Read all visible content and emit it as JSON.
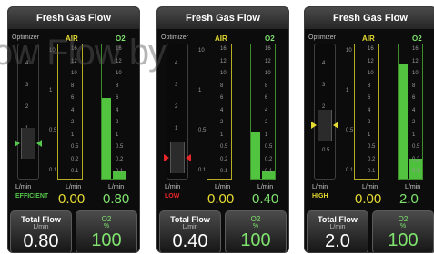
{
  "watermark": "ow Flow by",
  "panels": [
    {
      "title": "Fresh Gas Flow",
      "optimizer_label": "Optimizer",
      "air_label": "AIR",
      "o2_label": "O2",
      "unit_label": "L/min",
      "efficiency_status": "EFFICIENT",
      "efficiency_color": "#56c84b",
      "air_flow": "0.00",
      "o2_flow": "0.80",
      "o2_level": 0.6,
      "total_flow_label": "Total Flow",
      "total_flow_unit": "L/min",
      "total_flow": "0.80",
      "o2_percent_label": "O2",
      "o2_percent_unit": "%",
      "o2_percent": "100",
      "optimizer_ticks": [
        "4",
        "3",
        "2",
        "1",
        "0.5"
      ],
      "flow_ticks": [
        "10",
        "1",
        "0.5",
        "0.1"
      ],
      "o2_scale_ticks": [
        "16",
        "12",
        "10",
        "8",
        "6",
        "4",
        "2",
        "1",
        "0.5",
        "0.2",
        "0.1"
      ]
    },
    {
      "title": "Fresh Gas Flow",
      "optimizer_label": "Optimizer",
      "air_label": "AIR",
      "o2_label": "O2",
      "unit_label": "L/min",
      "efficiency_status": "LOW",
      "efficiency_color": "#e8262a",
      "air_flow": "0.00",
      "o2_flow": "0.40",
      "o2_level": 0.35,
      "total_flow_label": "Total Flow",
      "total_flow_unit": "L/min",
      "total_flow": "0.40",
      "o2_percent_label": "O2",
      "o2_percent_unit": "%",
      "o2_percent": "100",
      "optimizer_ticks": [
        "4",
        "3",
        "2",
        "1",
        "0.5"
      ],
      "flow_ticks": [
        "10",
        "1",
        "0.5",
        "0.1"
      ],
      "o2_scale_ticks": [
        "16",
        "12",
        "10",
        "8",
        "6",
        "4",
        "2",
        "1",
        "0.5",
        "0.2",
        "0.1"
      ]
    },
    {
      "title": "Fresh Gas Flow",
      "optimizer_label": "Optimizer",
      "air_label": "AIR",
      "o2_label": "O2",
      "unit_label": "L/min",
      "efficiency_status": "HIGH",
      "efficiency_color": "#e6dc32",
      "air_flow": "0.00",
      "o2_flow": "2.0",
      "o2_level": 0.85,
      "total_flow_label": "Total Flow",
      "total_flow_unit": "L/min",
      "total_flow": "2.0",
      "o2_percent_label": "O2",
      "o2_percent_unit": "%",
      "o2_percent": "100",
      "optimizer_ticks": [
        "4",
        "3",
        "2",
        "1",
        "0.5"
      ],
      "flow_ticks": [
        "10",
        "1",
        "0.5",
        "0.1"
      ],
      "o2_scale_ticks": [
        "16",
        "12",
        "10",
        "8",
        "6",
        "4",
        "2",
        "1",
        "0.5",
        "0.2",
        "0.1"
      ]
    }
  ]
}
